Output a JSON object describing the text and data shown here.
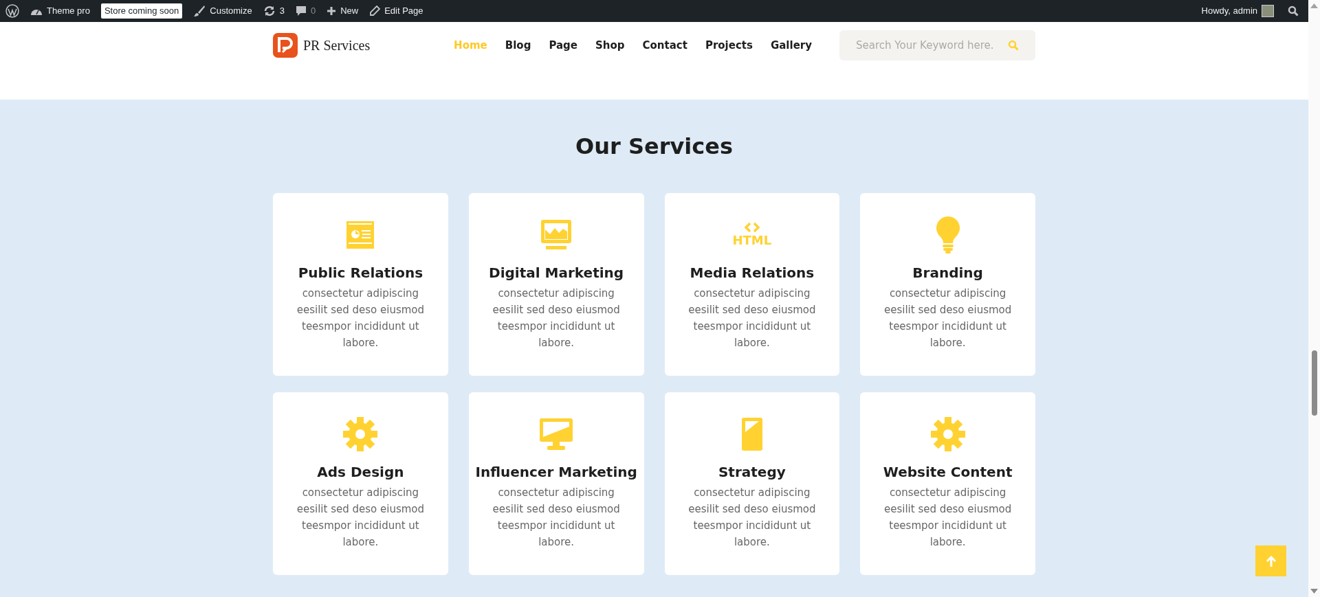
{
  "admin_bar": {
    "items": [
      {
        "kind": "wp-logo"
      },
      {
        "kind": "site",
        "label": "Theme pro"
      },
      {
        "kind": "badge",
        "label": "Store coming soon"
      },
      {
        "kind": "customize",
        "label": "Customize"
      },
      {
        "kind": "updates",
        "label": "3"
      },
      {
        "kind": "comments",
        "label": "0"
      },
      {
        "kind": "new",
        "label": "New"
      },
      {
        "kind": "edit",
        "label": "Edit Page"
      }
    ],
    "greeting": "Howdy, admin"
  },
  "header": {
    "logo_text": "PR Services",
    "nav": [
      {
        "label": "Home",
        "selected": true
      },
      {
        "label": "Blog",
        "selected": false
      },
      {
        "label": "Page",
        "selected": false
      },
      {
        "label": "Shop",
        "selected": false
      },
      {
        "label": "Contact",
        "selected": false
      },
      {
        "label": "Projects",
        "selected": false
      },
      {
        "label": "Gallery",
        "selected": false
      }
    ],
    "search": {
      "placeholder": "Search Your Keyword here."
    }
  },
  "services": {
    "title": "Our Services",
    "cards": [
      {
        "kind": "presentation",
        "title": "Public Relations",
        "text": "consectetur adipiscing eesilit sed deso eiusmod teesmpor incididunt ut labore."
      },
      {
        "kind": "monitor-chart",
        "title": "Digital Marketing",
        "text": "consectetur adipiscing eesilit sed deso eiusmod teesmpor incididunt ut labore."
      },
      {
        "kind": "html",
        "icon_text": "HTML",
        "title": "Media Relations",
        "text": "consectetur adipiscing eesilit sed deso eiusmod teesmpor incididunt ut labore."
      },
      {
        "kind": "bulb",
        "title": "Branding",
        "text": "consectetur adipiscing eesilit sed deso eiusmod teesmpor incididunt ut labore."
      },
      {
        "kind": "gear",
        "title": "Ads Design",
        "text": "consectetur adipiscing eesilit sed deso eiusmod teesmpor incididunt ut labore."
      },
      {
        "kind": "monitor",
        "title": "Influencer Marketing",
        "text": "consectetur adipiscing eesilit sed deso eiusmod teesmpor incididunt ut labore."
      },
      {
        "kind": "phone",
        "title": "Strategy",
        "text": "consectetur adipiscing eesilit sed deso eiusmod teesmpor incididunt ut labore."
      },
      {
        "kind": "gear",
        "title": "Website Content",
        "text": "consectetur adipiscing eesilit sed deso eiusmod teesmpor incididunt ut labore."
      }
    ]
  }
}
